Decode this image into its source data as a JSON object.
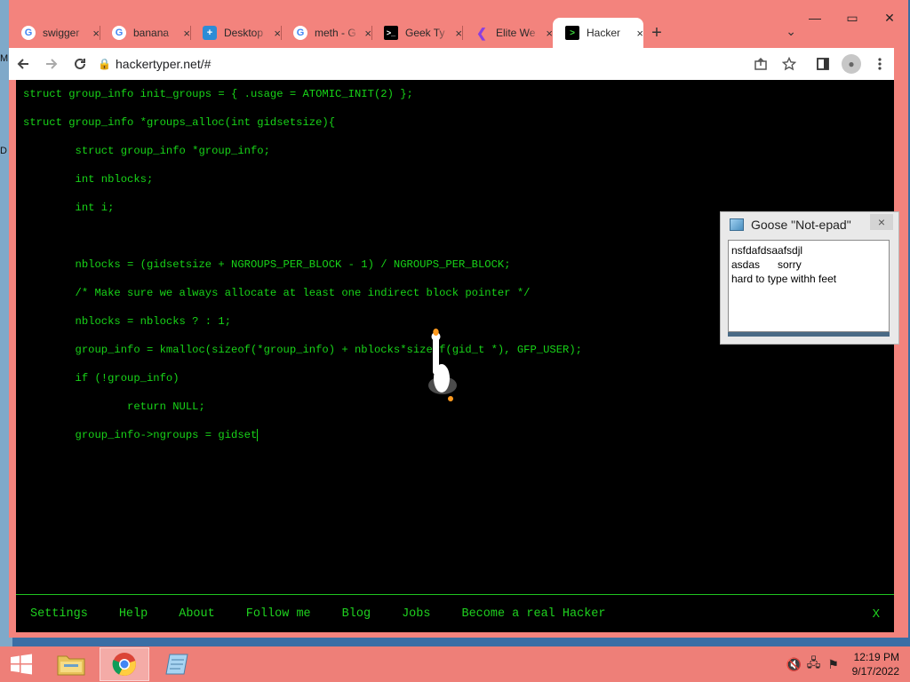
{
  "desktop": {
    "edge_letters": [
      "M",
      "D"
    ]
  },
  "browser": {
    "tabs": [
      {
        "title": "swigger",
        "icon": "google-icon"
      },
      {
        "title": "banana",
        "icon": "google-icon"
      },
      {
        "title": "Desktop",
        "icon": "desktop-app-icon"
      },
      {
        "title": "meth - G",
        "icon": "google-icon"
      },
      {
        "title": "Geek Ty",
        "icon": "terminal-icon"
      },
      {
        "title": "Elite We",
        "icon": "elite-icon"
      },
      {
        "title": "Hacker",
        "icon": "terminal-icon",
        "active": true
      }
    ],
    "new_tab": "+",
    "tab_search": "⌄",
    "close_tab": "×",
    "url": "hackertyper.net/#",
    "window_controls": {
      "minimize": "—",
      "maximize": "▭",
      "close": "✕"
    }
  },
  "code_lines": [
    "struct group_info init_groups = { .usage = ATOMIC_INIT(2) };",
    "struct group_info *groups_alloc(int gidsetsize){",
    "        struct group_info *group_info;",
    "        int nblocks;",
    "        int i;",
    "",
    "        nblocks = (gidsetsize + NGROUPS_PER_BLOCK - 1) / NGROUPS_PER_BLOCK;",
    "        /* Make sure we always allocate at least one indirect block pointer */",
    "        nblocks = nblocks ? : 1;",
    "        group_info = kmalloc(sizeof(*group_info) + nblocks*sizeof(gid_t *), GFP_USER);",
    "        if (!group_info)",
    "                return NULL;",
    "        group_info->ngroups = gidset"
  ],
  "footer": {
    "links": [
      "Settings",
      "Help",
      "About",
      "Follow me",
      "Blog",
      "Jobs",
      "Become a real Hacker"
    ],
    "close": "X"
  },
  "notepad": {
    "title": "Goose \"Not-epad\"",
    "close": "×",
    "lines": [
      "nsfdafdsaafsdjl",
      "asdas      sorry",
      "hard to type withh feet"
    ]
  },
  "taskbar": {
    "time": "12:19 PM",
    "date": "9/17/2022"
  },
  "colors": {
    "terminal_green": "#18d418",
    "chrome_frame": "#f3837d",
    "taskbar": "#ee7f78"
  }
}
